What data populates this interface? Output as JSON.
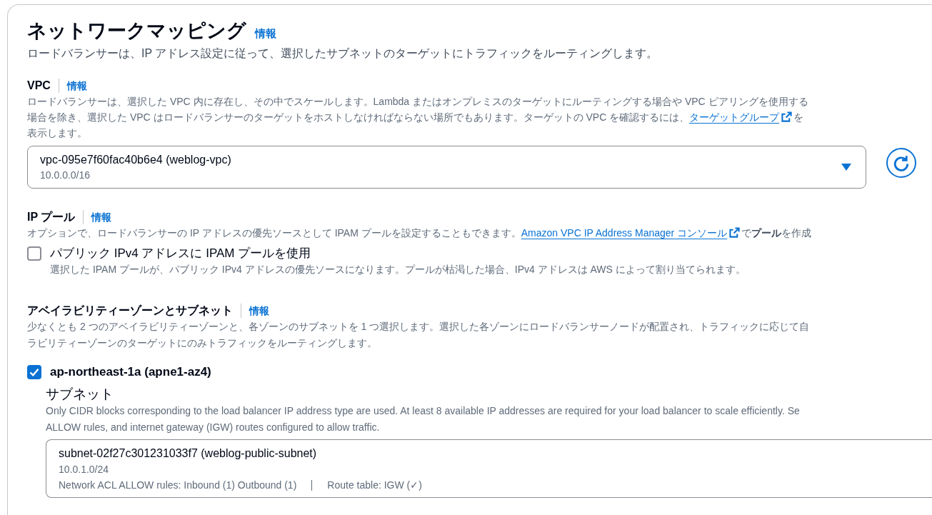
{
  "section": {
    "title": "ネットワークマッピング",
    "info_link": "情報",
    "description": "ロードバランサーは、IP アドレス設定に従って、選択したサブネットのターゲットにトラフィックをルーティングします。"
  },
  "vpc": {
    "label": "VPC",
    "info_link": "情報",
    "description": "ロードバランサーは、選択した VPC 内に存在し、その中でスケールします。Lambda またはオンプレミスのターゲットにルーティングする場合や VPC ピアリングを使用する場合を除き、選択した VPC はロードバランサーのターゲットをホストしなければならない場所でもあります。ターゲットの VPC を確認するには、",
    "description_link": "ターゲットグループ",
    "description_after": "を表示します。",
    "select": {
      "value": "vpc-095e7f60fac40b6e4 (weblog-vpc)",
      "detail": "10.0.0.0/16"
    }
  },
  "ip_pool": {
    "label": "IP プール",
    "info_link": "情報",
    "description": "オプションで、ロードバランサーの IP アドレスの優先ソースとして IPAM プールを設定することもできます。",
    "description_link": "Amazon VPC IP Address Manager コンソール",
    "description_after": "で**プール**を作成",
    "option": {
      "label": "パブリック IPv4 アドレスに IPAM プールを使用",
      "hint": "選択した IPAM プールが、パブリック IPv4 アドレスの優先ソースになります。プールが枯渇した場合、IPv4 アドレスは AWS によって割り当てられます。",
      "checked": false
    }
  },
  "availability_zones": {
    "label": "アベイラビリティーゾーンとサブネット",
    "info_link": "情報",
    "description_lines": [
      "少なくとも 2 つのアベイラビリティーゾーンと、各ゾーンのサブネットを 1 つ選択します。選択した各ゾーンにロードバランサーノードが配置され、トラフィックに応じて自",
      "ラビリティーゾーンのターゲットにのみトラフィックをルーティングします。"
    ],
    "zones": [
      {
        "label": "ap-northeast-1a (apne1-az4)",
        "checked": true,
        "subnet": {
          "label": "サブネット",
          "description_lines": [
            "Only CIDR blocks corresponding to the load balancer IP address type are used. At least 8 available IP addresses are required for your load balancer to scale efficiently. Se",
            "ALLOW rules, and internet gateway (IGW) routes configured to allow traffic."
          ],
          "select": {
            "value": "subnet-02f27c301231033f7 (weblog-public-subnet)",
            "detail": "10.0.1.0/24",
            "tags": [
              "Network ACL ALLOW rules: Inbound (1) Outbound (1)",
              "Route table: IGW (✓)"
            ]
          }
        }
      }
    ]
  }
}
